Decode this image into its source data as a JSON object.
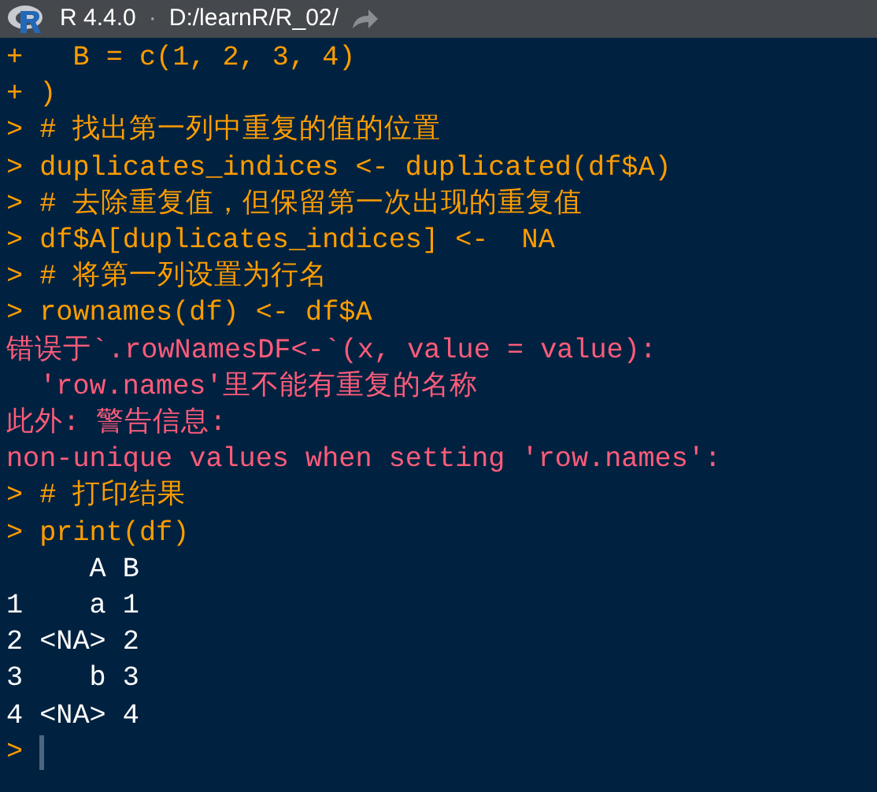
{
  "title_bar": {
    "version": "R 4.4.0",
    "separator": "·",
    "path": "D:/learnR/R_02/"
  },
  "console": {
    "lines": [
      {
        "kind": "input",
        "text": "+   B = c(1, 2, 3, 4)"
      },
      {
        "kind": "input",
        "text": "+ )"
      },
      {
        "kind": "input",
        "text": "> # 找出第一列中重复的值的位置"
      },
      {
        "kind": "input",
        "text": "> duplicates_indices <- duplicated(df$A)"
      },
      {
        "kind": "input",
        "text": "> # 去除重复值，但保留第一次出现的重复值"
      },
      {
        "kind": "input",
        "text": "> df$A[duplicates_indices] <-  NA"
      },
      {
        "kind": "input",
        "text": "> # 将第一列设置为行名"
      },
      {
        "kind": "input",
        "text": "> rownames(df) <- df$A"
      },
      {
        "kind": "error",
        "text": "错误于`.rowNamesDF<-`(x, value = value):"
      },
      {
        "kind": "error",
        "text": "  'row.names'里不能有重复的名称"
      },
      {
        "kind": "error",
        "text": "此外: 警告信息:"
      },
      {
        "kind": "error",
        "text": "non-unique values when setting 'row.names':"
      },
      {
        "kind": "input",
        "text": "> # 打印结果"
      },
      {
        "kind": "input",
        "text": "> print(df)"
      },
      {
        "kind": "output",
        "text": "     A B"
      },
      {
        "kind": "output",
        "text": "1    a 1"
      },
      {
        "kind": "output",
        "text": "2 <NA> 2"
      },
      {
        "kind": "output",
        "text": "3    b 3"
      },
      {
        "kind": "output",
        "text": "4 <NA> 4"
      }
    ],
    "prompt": ">"
  }
}
